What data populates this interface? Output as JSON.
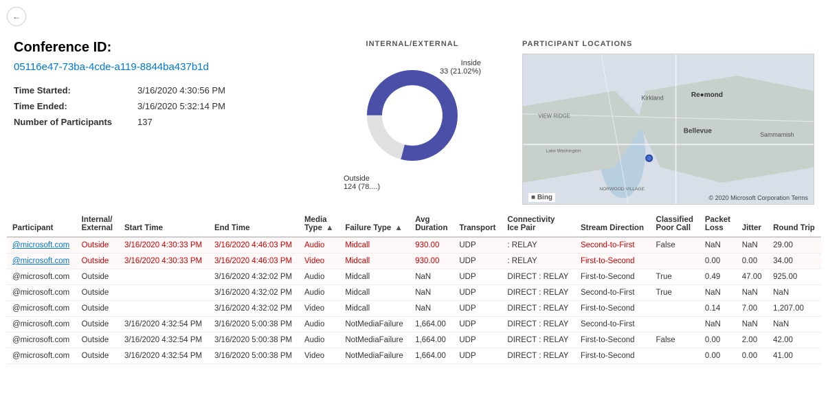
{
  "back_button": "←",
  "conference": {
    "title": "Conference ID:",
    "id": "05116e47-73ba-4cde-a119-8844ba437b1d",
    "time_started_label": "Time Started:",
    "time_started_value": "3/16/2020 4:30:56 PM",
    "time_ended_label": "Time Ended:",
    "time_ended_value": "3/16/2020 5:32:14 PM",
    "participants_label": "Number of Participants",
    "participants_value": "137"
  },
  "internal_external_chart": {
    "title": "INTERNAL/EXTERNAL",
    "inside_label": "Inside",
    "inside_value": "33 (21.02%)",
    "outside_label": "Outside",
    "outside_value": "124 (78....)",
    "inside_pct": 21,
    "outside_pct": 79
  },
  "map": {
    "title": "PARTICIPANT LOCATIONS",
    "bing_label": "Bing",
    "copyright": "© 2020 Microsoft Corporation Terms",
    "dot_x": "42%",
    "dot_y": "66%"
  },
  "table": {
    "columns": [
      {
        "id": "participant",
        "label": "Participant"
      },
      {
        "id": "internal_external",
        "label": "Internal/ External"
      },
      {
        "id": "start_time",
        "label": "Start Time"
      },
      {
        "id": "end_time",
        "label": "End Time"
      },
      {
        "id": "media_type",
        "label": "Media Type",
        "sortable": true
      },
      {
        "id": "failure_type",
        "label": "Failure Type",
        "sortable": true
      },
      {
        "id": "avg_duration",
        "label": "Avg Duration"
      },
      {
        "id": "transport",
        "label": "Transport"
      },
      {
        "id": "connectivity",
        "label": "Connectivity Ice Pair"
      },
      {
        "id": "stream_direction",
        "label": "Stream Direction"
      },
      {
        "id": "classified_poor_call",
        "label": "Classified Poor Call"
      },
      {
        "id": "packet_loss",
        "label": "Packet Loss"
      },
      {
        "id": "jitter",
        "label": "Jitter"
      },
      {
        "id": "round_trip",
        "label": "Round Trip"
      }
    ],
    "rows": [
      {
        "participant": "@microsoft.com",
        "internal_external": "Outside",
        "start_time": "3/16/2020 4:30:33 PM",
        "end_time": "3/16/2020 4:46:03 PM",
        "media_type": "Audio",
        "failure_type": "Midcall",
        "avg_duration": "930.00",
        "transport": "UDP",
        "connectivity": ": RELAY",
        "stream_direction": "Second-to-First",
        "classified_poor_call": "False",
        "packet_loss": "NaN",
        "jitter": "NaN",
        "round_trip": "29.00",
        "highlight": true
      },
      {
        "participant": "@microsoft.com",
        "internal_external": "Outside",
        "start_time": "3/16/2020 4:30:33 PM",
        "end_time": "3/16/2020 4:46:03 PM",
        "media_type": "Video",
        "failure_type": "Midcall",
        "avg_duration": "930.00",
        "transport": "UDP",
        "connectivity": ": RELAY",
        "stream_direction": "First-to-Second",
        "classified_poor_call": "",
        "packet_loss": "0.00",
        "jitter": "0.00",
        "round_trip": "34.00",
        "highlight": true
      },
      {
        "participant": "@microsoft.com",
        "internal_external": "Outside",
        "start_time": "",
        "end_time": "3/16/2020 4:32:02 PM",
        "media_type": "Audio",
        "failure_type": "Midcall",
        "avg_duration": "NaN",
        "transport": "UDP",
        "connectivity": "DIRECT : RELAY",
        "stream_direction": "First-to-Second",
        "classified_poor_call": "True",
        "packet_loss": "0.49",
        "jitter": "47.00",
        "round_trip": "925.00",
        "highlight": false
      },
      {
        "participant": "@microsoft.com",
        "internal_external": "Outside",
        "start_time": "",
        "end_time": "3/16/2020 4:32:02 PM",
        "media_type": "Audio",
        "failure_type": "Midcall",
        "avg_duration": "NaN",
        "transport": "UDP",
        "connectivity": "DIRECT : RELAY",
        "stream_direction": "Second-to-First",
        "classified_poor_call": "True",
        "packet_loss": "NaN",
        "jitter": "NaN",
        "round_trip": "NaN",
        "highlight": false
      },
      {
        "participant": "@microsoft.com",
        "internal_external": "Outside",
        "start_time": "",
        "end_time": "3/16/2020 4:32:02 PM",
        "media_type": "Video",
        "failure_type": "Midcall",
        "avg_duration": "NaN",
        "transport": "UDP",
        "connectivity": "DIRECT : RELAY",
        "stream_direction": "First-to-Second",
        "classified_poor_call": "",
        "packet_loss": "0.14",
        "jitter": "7.00",
        "round_trip": "1,207.00",
        "highlight": false
      },
      {
        "participant": "@microsoft.com",
        "internal_external": "Outside",
        "start_time": "3/16/2020 4:32:54 PM",
        "end_time": "3/16/2020 5:00:38 PM",
        "media_type": "Audio",
        "failure_type": "NotMediaFailure",
        "avg_duration": "1,664.00",
        "transport": "UDP",
        "connectivity": "DIRECT : RELAY",
        "stream_direction": "Second-to-First",
        "classified_poor_call": "",
        "packet_loss": "NaN",
        "jitter": "NaN",
        "round_trip": "NaN",
        "highlight": false
      },
      {
        "participant": "@microsoft.com",
        "internal_external": "Outside",
        "start_time": "3/16/2020 4:32:54 PM",
        "end_time": "3/16/2020 5:00:38 PM",
        "media_type": "Audio",
        "failure_type": "NotMediaFailure",
        "avg_duration": "1,664.00",
        "transport": "UDP",
        "connectivity": "DIRECT : RELAY",
        "stream_direction": "First-to-Second",
        "classified_poor_call": "False",
        "packet_loss": "0.00",
        "jitter": "2.00",
        "round_trip": "42.00",
        "highlight": false
      },
      {
        "participant": "@microsoft.com",
        "internal_external": "Outside",
        "start_time": "3/16/2020 4:32:54 PM",
        "end_time": "3/16/2020 5:00:38 PM",
        "media_type": "Video",
        "failure_type": "NotMediaFailure",
        "avg_duration": "1,664.00",
        "transport": "UDP",
        "connectivity": "DIRECT : RELAY",
        "stream_direction": "First-to-Second",
        "classified_poor_call": "",
        "packet_loss": "0.00",
        "jitter": "0.00",
        "round_trip": "41.00",
        "highlight": false
      }
    ]
  }
}
